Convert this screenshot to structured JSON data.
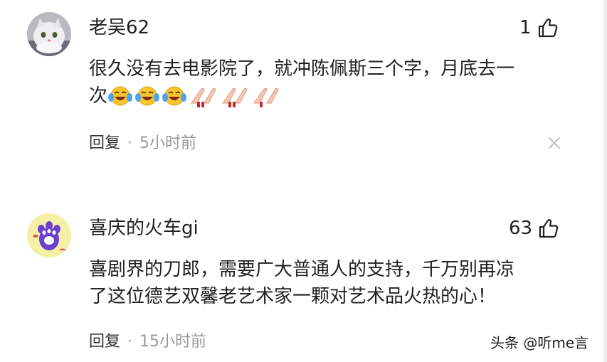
{
  "comments": [
    {
      "username": "老吴62",
      "likes": "1",
      "text_line1": "很久没有去电影院了，就冲陈佩斯三个字，月底去一",
      "text_line2": "次",
      "emojis": [
        "laugh-cry",
        "laugh-cry",
        "laugh-cry",
        "clap",
        "clap",
        "clap"
      ],
      "reply_label": "回复",
      "dot": "·",
      "time": "5小时前"
    },
    {
      "username": "喜庆的火车gi",
      "likes": "63",
      "text_line1": "喜剧界的刀郎，需要广大普通人的支持，千万别再凉",
      "text_line2": "了这位德艺双馨老艺术家一颗对艺术品火热的心！",
      "reply_label": "回复",
      "dot": "·",
      "time": "15小时前"
    }
  ],
  "watermark": "头条 @听me言",
  "colors": {
    "text_primary": "#222222",
    "text_secondary": "#999999",
    "avatar2_bg": "#f4f0a6",
    "paw": "#6b3fd1"
  },
  "icons": {
    "like": "thumbs-up-icon",
    "close": "close-icon"
  }
}
